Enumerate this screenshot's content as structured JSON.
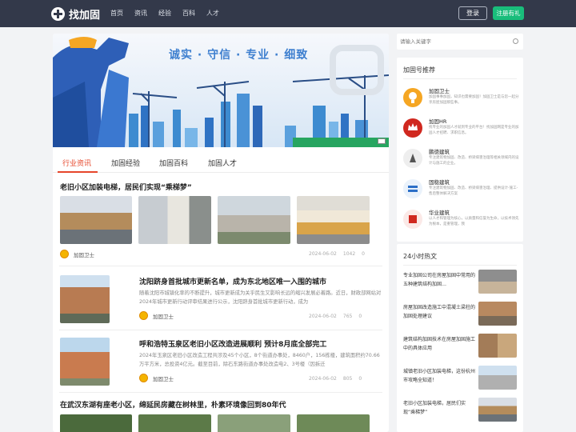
{
  "header": {
    "logo_text": "找加固",
    "nav": [
      "首页",
      "资讯",
      "经验",
      "百科",
      "人才"
    ],
    "login_label": "登录",
    "register_label": "注册有礼"
  },
  "banner": {
    "slogan": "诚实 · 守信 · 专业 · 细致"
  },
  "tabs": [
    "行业资讯",
    "加固经验",
    "加固百科",
    "加固人才"
  ],
  "articles": [
    {
      "title": "老旧小区加装电梯，居民们实现“乘梯梦”",
      "author": "加固卫士",
      "date": "2024-06-02",
      "views": "1042",
      "likes": "0"
    },
    {
      "title": "沈阳跻身首批城市更新名单，成为东北地区唯一入围的城市",
      "desc": "随着沈阳市城镇化率的不断提升，城市更新成为关乎民生又影响长远的缩兴发展必着路。近日，财政部网站对2024年城市更新行动评审结果进行公示，沈阳跻身首批城市更新行动，成为",
      "author": "加固卫士",
      "date": "2024-06-02",
      "views": "765",
      "likes": "0"
    },
    {
      "title": "呼和浩特玉泉区老旧小区改造进展顺利 预计8月底全部完工",
      "desc": "2024年玉泉区老旧小区改造工程共涉及45个小区，8个街道办事处，8460户，156栋楼，建筑面积约70.66万平方米，总投资4亿元。截至目前，除石东路街道办事处改造电2、3号楼（因拆迁",
      "author": "加固卫士",
      "date": "2024-06-02",
      "views": "805",
      "likes": "0"
    },
    {
      "title": "在武汉东湖有座老小区，绵延民房藏在树林里，朴素环境像回到80年代"
    }
  ],
  "search": {
    "placeholder": "请输入关键字"
  },
  "recommend": {
    "title": "加固号推荐",
    "items": [
      {
        "name": "加固卫士",
        "desc": "加固事事加固，知识也需要加固！加固卫士是与您一起分享房屋加固那些事。"
      },
      {
        "name": "加固HR",
        "desc": "找专业的加固人才就到专业的平台！找加固网是专业的加固人才招聘、求职信息。"
      },
      {
        "name": "鹏徳建筑",
        "desc": "专注建筑物加固、改造、桥梁病害治理等相关领域内的设计与施工的企业。"
      },
      {
        "name": "固稳建筑",
        "desc": "专注建筑物加固、改造、桥梁病害治理、提供设计-施工-售后整体解决方案"
      },
      {
        "name": "华业建筑",
        "desc": "以人才和管理为核心，以质量和信誉为生命，以技术领先为根本，是重管理，我"
      }
    ]
  },
  "hot": {
    "title": "24小时热文",
    "items": [
      "专业加固公司在房屋加固中常用的五种建筑结构加固…",
      "房屋加固改造施工中混凝土梁柱的加固处理建议",
      "建筑结构加固技术在房屋加固施工中的具体应用",
      "城镇老旧小区加装电梯，这份杭州市攻略全知道！",
      "老旧小区加装电梯，居民们实现“乘梯梦”"
    ]
  },
  "colors": {
    "topbar": "#33394a",
    "accent_green": "#19bd7b",
    "tab_active": "#e6462a",
    "link_blue": "#3e7fcf"
  }
}
